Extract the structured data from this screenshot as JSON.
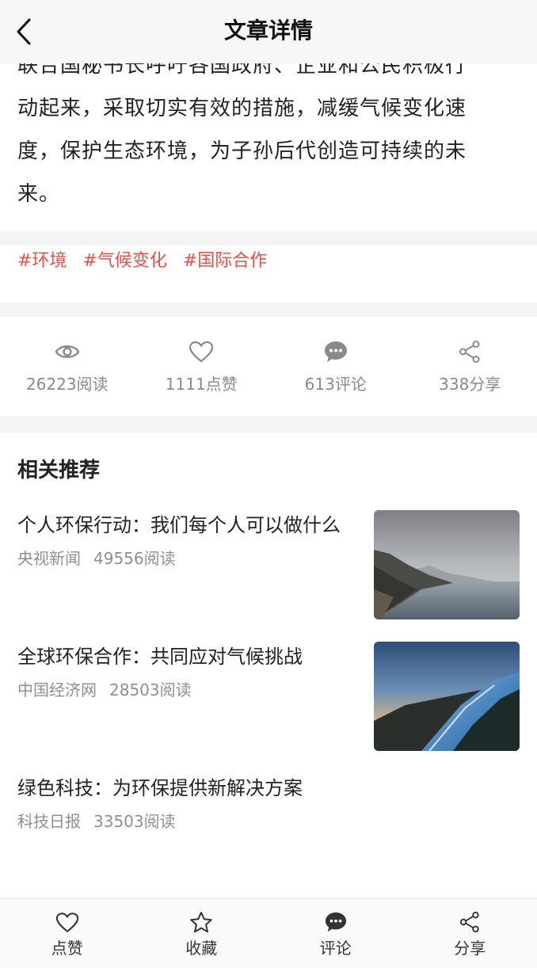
{
  "header": {
    "title": "文章详情"
  },
  "article": {
    "lines": [
      "联合国秘书长呼吁各国政府、企业和公民积极行",
      "动起来，采取切实有效的措施，减缓气候变化速",
      "度，保护生态环境，为子孙后代创造可持续的未",
      "来。"
    ]
  },
  "tags": [
    "#环境",
    "#气候变化",
    "#国际合作"
  ],
  "stats": {
    "views": "26223阅读",
    "likes": "1111点赞",
    "comments": "613评论",
    "shares": "338分享"
  },
  "related": {
    "title": "相关推荐",
    "items": [
      {
        "headline": "个人环保行动：我们每个人可以做什么",
        "source": "央视新闻",
        "reads": "49556阅读",
        "image": "coastal-mountains-photo"
      },
      {
        "headline": "全球环保合作：共同应对气候挑战",
        "source": "中国经济网",
        "reads": "28503阅读",
        "image": "mountain-road-sunset-photo"
      },
      {
        "headline": "绿色科技：为环保提供新解决方案",
        "source": "科技日报",
        "reads": "33503阅读"
      }
    ]
  },
  "bottom_bar": {
    "like": "点赞",
    "favorite": "收藏",
    "comment": "评论",
    "share": "分享"
  },
  "colors": {
    "tag": "#e0524a",
    "meta": "#8a8a8a",
    "header_bg": "#f7f7f7"
  }
}
